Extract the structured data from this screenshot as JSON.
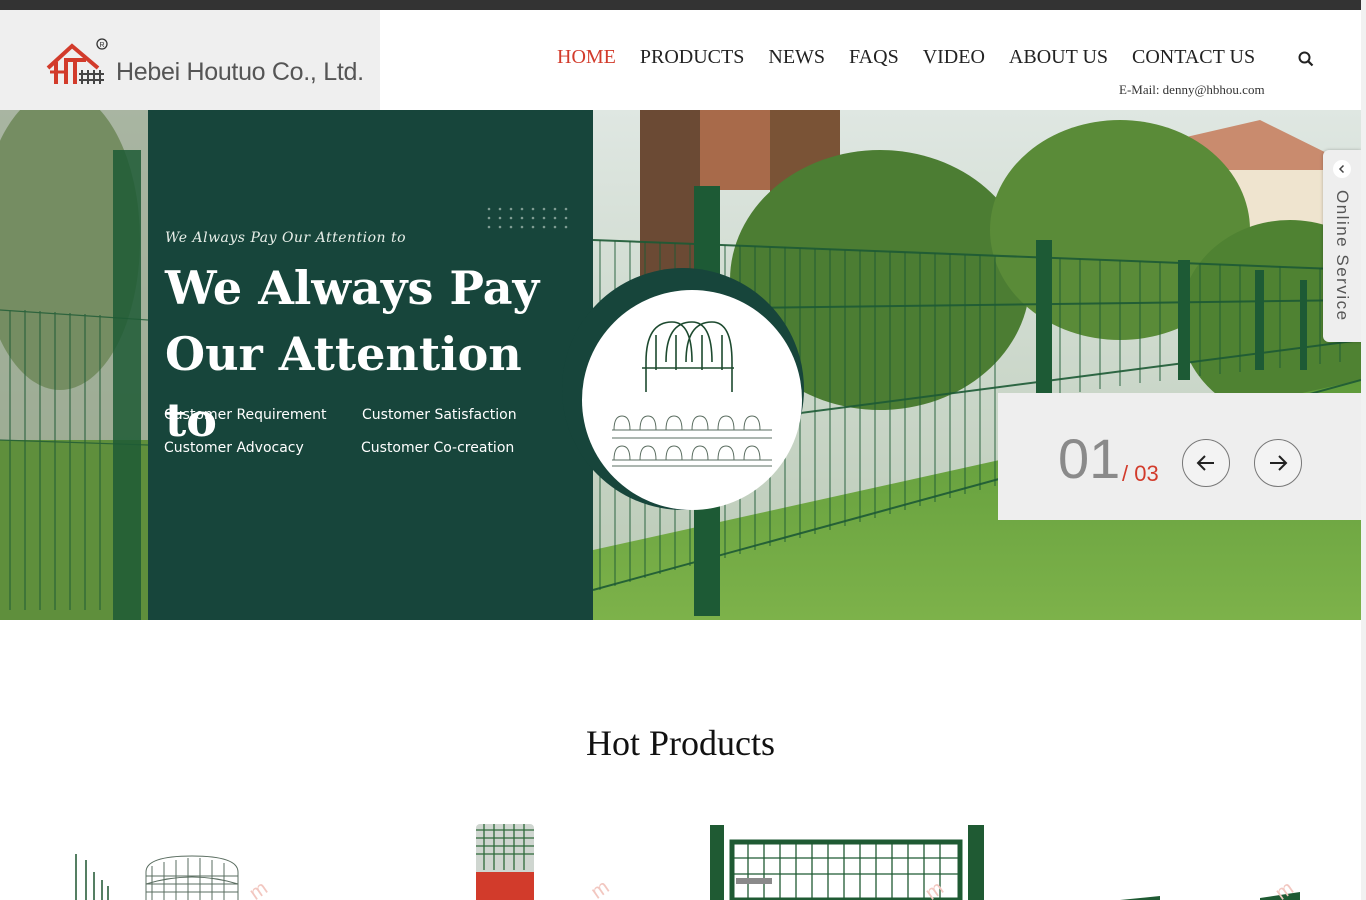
{
  "header": {
    "company_name": "Hebei Houtuo Co., Ltd.",
    "email": "E-Mail: denny@hbhou.com"
  },
  "nav": [
    {
      "label": "HOME",
      "active": true
    },
    {
      "label": "PRODUCTS",
      "active": false
    },
    {
      "label": "NEWS",
      "active": false
    },
    {
      "label": "FAQS",
      "active": false
    },
    {
      "label": "VIDEO",
      "active": false
    },
    {
      "label": "ABOUT US",
      "active": false
    },
    {
      "label": "CONTACT US",
      "active": false
    }
  ],
  "hero": {
    "script_line": "We Always Pay Our Attention to",
    "title": "We Always Pay Our Attention to",
    "features": [
      "Customer Requirement",
      "Customer Satisfaction",
      "Customer Advocacy",
      "Customer Co-creation"
    ],
    "slide_current": "01",
    "slide_total": "/ 03"
  },
  "online_service": "Online Service",
  "hot_products": {
    "title": "Hot Products"
  },
  "colors": {
    "accent": "#d23b2b",
    "panel": "#17453b",
    "fence": "#1d5a35"
  }
}
